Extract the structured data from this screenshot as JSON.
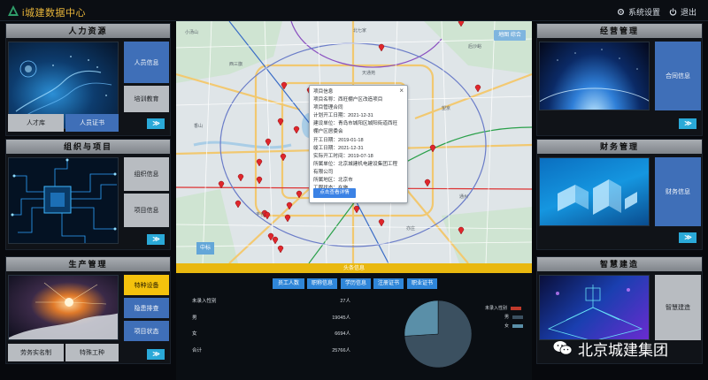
{
  "app": {
    "title": "i城建数据中心"
  },
  "header": {
    "settings_label": "系统设置",
    "logout_label": "退出"
  },
  "left": {
    "hr": {
      "title": "人力资源",
      "tiles": [
        "人员信息",
        "培训教育"
      ],
      "bottom_buttons": [
        "人才库",
        "人员证书"
      ]
    },
    "org": {
      "title": "组织与项目",
      "tiles": [
        "组织信息",
        "项目信息"
      ]
    },
    "prod": {
      "title": "生产管理",
      "tiles": [
        "特种设备",
        "隐患排查",
        "项目状态"
      ],
      "bottom_buttons": [
        "劳务实名制",
        "特殊工种"
      ]
    }
  },
  "right": {
    "ops": {
      "title": "经营管理",
      "tiles": [
        "合同信息"
      ]
    },
    "fin": {
      "title": "财务管理",
      "tiles": [
        "财务信息"
      ]
    },
    "smart": {
      "title": "智慧建造",
      "tiles": [
        "智慧建造"
      ]
    }
  },
  "next_glyph": "≫",
  "map": {
    "toggle_label": "地图  综合",
    "badge_label": "中标",
    "popup": {
      "close": "×",
      "lines": [
        "项目信息",
        "项目名称：西旺棚户区改造项目",
        "项目管理合同",
        "计划开工日期：2021-12-31",
        "建设单位：青岛市城阳区城阳街道西旺",
        "棚户区居委会",
        "开工日期：2019-01-18",
        "竣工日期：2021-12-31",
        "实际开工时间：2019-07-18",
        "所属单位：北京城建机电建设集团工程",
        "有限公司",
        "所属地区：北京市",
        "工程状态：在施"
      ],
      "button_label": "点击查看详情"
    }
  },
  "info": {
    "title": "头条信息",
    "tabs": [
      "员工人数",
      "职称信息",
      "学历信息",
      "注册证书",
      "职业证书"
    ],
    "rows": [
      {
        "label": "未录入性别",
        "value": "27人"
      },
      {
        "label": "男",
        "value": "19045人"
      },
      {
        "label": "女",
        "value": "6694人"
      },
      {
        "label": "合计",
        "value": "25766人"
      }
    ],
    "legend": [
      {
        "label": "未录入性别",
        "color": "#c0392b"
      },
      {
        "label": "男",
        "color": "#3b5060"
      },
      {
        "label": "女",
        "color": "#5a8fa8"
      }
    ]
  },
  "chart_data": {
    "type": "pie",
    "categories": [
      "未录入性别",
      "男",
      "女"
    ],
    "values": [
      27,
      19045,
      6694
    ],
    "colors": [
      "#c0392b",
      "#3b5060",
      "#5a8fa8"
    ]
  },
  "watermark": {
    "text": "北京城建集团"
  }
}
